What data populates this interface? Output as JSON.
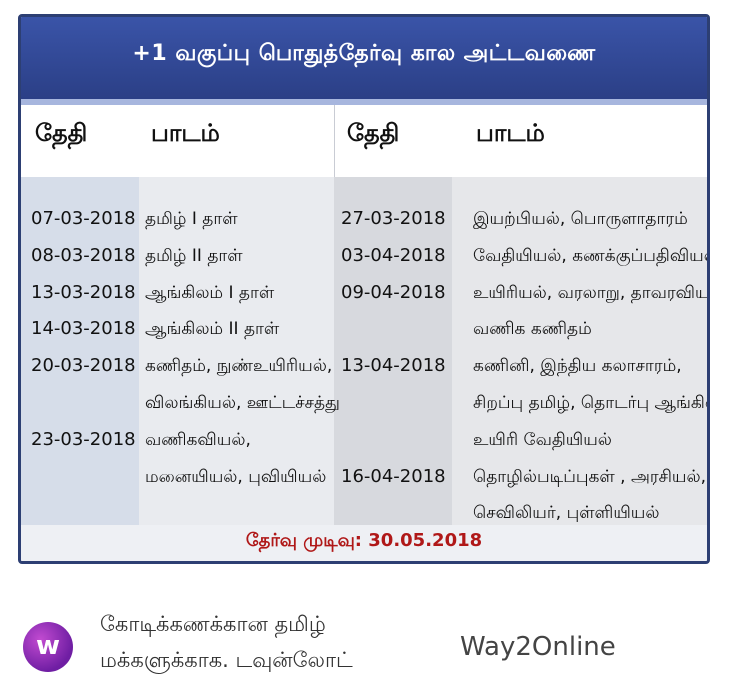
{
  "title": "+1 வகுப்பு பொதுத்தேர்வு கால அட்டவணை",
  "headers": {
    "date_left": "தேதி",
    "subject_left": "பாடம்",
    "date_right": "தேதி",
    "subject_right": "பாடம்"
  },
  "left_rows": [
    {
      "date": "07-03-2018",
      "subject": "தமிழ் I தாள்"
    },
    {
      "date": "08-03-2018",
      "subject": "தமிழ் II தாள்"
    },
    {
      "date": "13-03-2018",
      "subject": "ஆங்கிலம் I தாள்"
    },
    {
      "date": "14-03-2018",
      "subject": "ஆங்கிலம் II தாள்"
    },
    {
      "date": "20-03-2018",
      "subject": "கணிதம், நுண்உயிரியல்,"
    },
    {
      "date": "",
      "subject": "விலங்கியல், ஊட்டச்சத்து"
    },
    {
      "date": "23-03-2018",
      "subject": "வணிகவியல்,"
    },
    {
      "date": "",
      "subject": "மனையியல், புவியியல்"
    }
  ],
  "right_rows": [
    {
      "date": "27-03-2018",
      "subject": "இயற்பியல், பொருளாதாரம்"
    },
    {
      "date": "03-04-2018",
      "subject": "வேதியியல், கணக்குப்பதிவியல்"
    },
    {
      "date": "09-04-2018",
      "subject": "உயிரியல், வரலாறு, தாவரவியல்,"
    },
    {
      "date": "",
      "subject": "வணிக கணிதம்"
    },
    {
      "date": "13-04-2018",
      "subject": "கணினி, இந்திய கலாசாரம்,"
    },
    {
      "date": "",
      "subject": "சிறப்பு தமிழ், தொடர்பு ஆங்கிலம்,"
    },
    {
      "date": "",
      "subject": "உயிரி வேதியியல்"
    },
    {
      "date": "16-04-2018",
      "subject": "தொழில்படிப்புகள் , அரசியல்,"
    },
    {
      "date": "",
      "subject": "செவிலியர், புள்ளியியல்"
    }
  ],
  "result": "தேர்வு முடிவு: 30.05.2018",
  "app": {
    "logo_letter": "w",
    "promo_line1": "கோடிக்கணக்கான தமிழ்",
    "promo_line2": "மக்களுக்காக. டவுன்லோட்",
    "brand": "Way2Online"
  },
  "colors": {
    "title_bar": "#2b3f86",
    "result_text": "#b01818",
    "logo": "#6f1ea3"
  }
}
